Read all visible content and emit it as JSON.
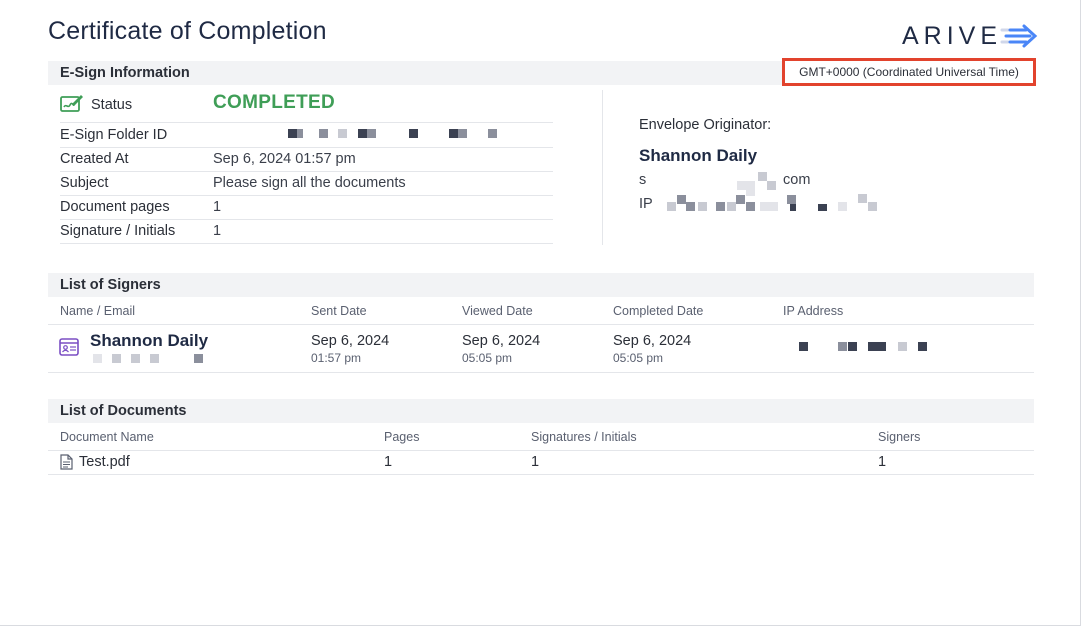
{
  "title": "Certificate of Completion",
  "logo": {
    "text": "ARIVE",
    "arrow_color": "#4a86f7"
  },
  "esign": {
    "section_title": "E-Sign Information",
    "timezone": "GMT+0000 (Coordinated Universal Time)",
    "status_label": "Status",
    "status_value": "COMPLETED",
    "status_color": "#3f9e57",
    "folder_id_label": "E-Sign Folder ID",
    "created_label": "Created At",
    "created_value": "Sep 6, 2024 01:57 pm",
    "subject_label": "Subject",
    "subject_value": "Please sign all the documents",
    "pages_label": "Document pages",
    "pages_value": "1",
    "sig_label": "Signature / Initials",
    "sig_value": "1",
    "originator_label": "Envelope Originator:",
    "originator_name": "Shannon Daily",
    "originator_email_prefix": "s",
    "originator_email_suffix": "com",
    "originator_ip_label": "IP"
  },
  "signers": {
    "section_title": "List of Signers",
    "headers": [
      "Name / Email",
      "Sent Date",
      "Viewed Date",
      "Completed Date",
      "IP Address"
    ],
    "rows": [
      {
        "name": "Shannon Daily",
        "sent_date": "Sep 6, 2024",
        "sent_time": "01:57 pm",
        "viewed_date": "Sep 6, 2024",
        "viewed_time": "05:05 pm",
        "completed_date": "Sep 6, 2024",
        "completed_time": "05:05 pm"
      }
    ]
  },
  "documents": {
    "section_title": "List of Documents",
    "headers": [
      "Document Name",
      "Pages",
      "Signatures / Initials",
      "Signers"
    ],
    "rows": [
      {
        "name": "Test.pdf",
        "pages": "1",
        "signatures": "1",
        "signers": "1"
      }
    ]
  },
  "colors": {
    "accent_red": "#e2432d",
    "icon_purple": "#7b4fc4",
    "icon_green": "#3f9e57"
  }
}
